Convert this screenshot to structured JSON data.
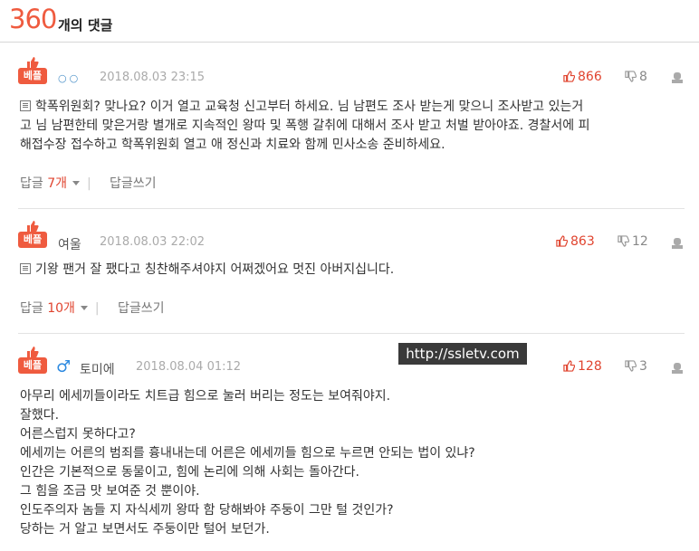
{
  "header": {
    "count": "360",
    "count_label": "개의 댓글"
  },
  "best_tag": "베플",
  "comments": [
    {
      "nickname": "",
      "date": "2018.08.03 23:15",
      "likes": "866",
      "dislikes": "8",
      "lines": [
        "학폭위원회? 맞나요? 이거 열고 교육청 신고부터 하세요. 님 남편도 조사 받는게 맞으니 조사받고 있는거",
        "고 님 남편한테 맞은거랑 별개로 지속적인 왕따 및 폭행 갈취에 대해서 조사 받고 처벌 받아야죠. 경찰서에 피",
        "해접수장 접수하고 학폭위원회 열고 애 정신과 치료와 함께 민사소송 준비하세요."
      ],
      "reply_label": "답글",
      "reply_count": "7개",
      "write_label": "답글쓰기"
    },
    {
      "nickname": "여울",
      "date": "2018.08.03 22:02",
      "likes": "863",
      "dislikes": "12",
      "lines": [
        "기왕 팬거 잘 팼다고 칭찬해주셔야지 어쩌겠어요 멋진 아버지십니다."
      ],
      "reply_label": "답글",
      "reply_count": "10개",
      "write_label": "답글쓰기"
    },
    {
      "nickname": "토미에",
      "gender_symbol": "♂",
      "date": "2018.08.04 01:12",
      "likes": "128",
      "dislikes": "3",
      "lines": [
        "아무리 에세끼들이라도 치트급 힘으로 눌러 버리는 정도는 보여줘야지.",
        "잘했다.",
        "어른스럽지 못하다고?",
        "에세끼는 어른의 범죄를 흉내내는데 어른은 에세끼들 힘으로 누르면 안되는 법이 있냐?",
        "인간은 기본적으로 동물이고, 힘에 논리에 의해 사회는 돌아간다.",
        "그 힘을 조금 맛 보여준 것 뿐이야.",
        "인도주의자 놈들 지 자식세끼 왕따 함 당해봐야 주둥이 그만 털 것인가?",
        "당하는 거 알고 보면서도 주둥이만 털어 보던가."
      ]
    }
  ],
  "watermark": "http://ssletv.com",
  "colors": {
    "accent": "#ef5b3f",
    "male": "#2d8ae0"
  }
}
